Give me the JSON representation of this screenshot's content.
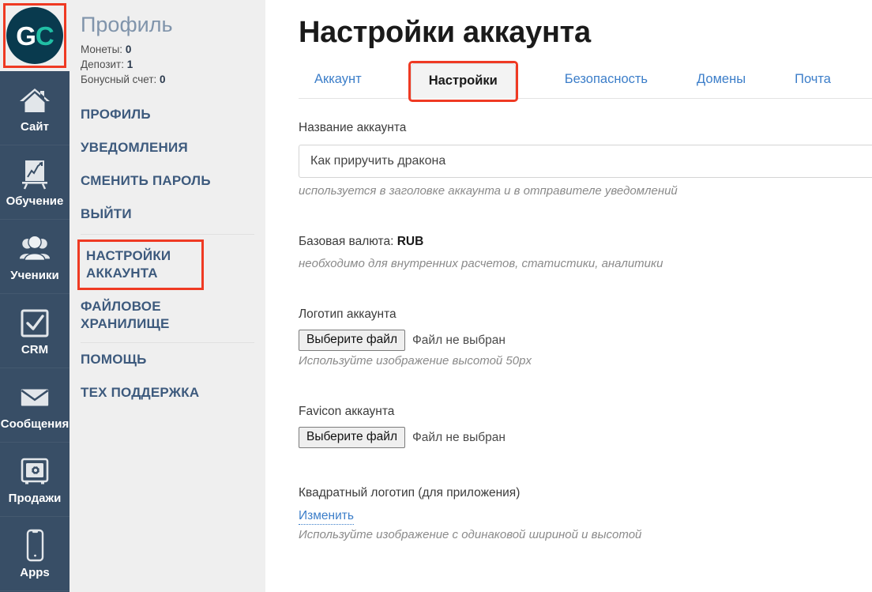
{
  "rail": {
    "logo": {
      "left": "G",
      "right": "C",
      "name": "gc-logo"
    },
    "items": [
      {
        "label": "Сайт",
        "icon": "home-icon"
      },
      {
        "label": "Обучение",
        "icon": "chart-board-icon"
      },
      {
        "label": "Ученики",
        "icon": "users-icon"
      },
      {
        "label": "CRM",
        "icon": "checkbox-check-icon"
      },
      {
        "label": "Сообщения",
        "icon": "envelope-icon"
      },
      {
        "label": "Продажи",
        "icon": "safe-box-icon"
      },
      {
        "label": "Apps",
        "icon": "phone-icon"
      }
    ]
  },
  "profile": {
    "title": "Профиль",
    "stats": [
      {
        "label": "Монеты:",
        "value": "0"
      },
      {
        "label": "Депозит:",
        "value": "1"
      },
      {
        "label": "Бонусный счет:",
        "value": "0"
      }
    ],
    "menu": [
      {
        "label": "ПРОФИЛЬ"
      },
      {
        "label": "УВЕДОМЛЕНИЯ"
      },
      {
        "label": "СМЕНИТЬ ПАРОЛЬ"
      },
      {
        "label": "ВЫЙТИ"
      },
      {
        "label": "НАСТРОЙКИ АККАУНТА"
      },
      {
        "label": "ФАЙЛОВОЕ ХРАНИЛИЩЕ"
      },
      {
        "label": "ПОМОЩЬ"
      },
      {
        "label": "ТЕХ ПОДДЕРЖКА"
      }
    ]
  },
  "main": {
    "page_title": "Настройки аккаунта",
    "tabs": [
      {
        "label": "Аккаунт",
        "active": false
      },
      {
        "label": "Настройки",
        "active": true
      },
      {
        "label": "Безопасность",
        "active": false
      },
      {
        "label": "Домены",
        "active": false
      },
      {
        "label": "Почта",
        "active": false
      }
    ],
    "fields": {
      "account_name": {
        "label": "Название аккаунта",
        "value": "Как приручить дракона",
        "placeholder": "Как приручить дракона",
        "hint": "используется в заголовке аккаунта и в отправителе уведомлений"
      },
      "base_currency": {
        "label": "Базовая валюта:",
        "value": "RUB",
        "hint": "необходимо для внутренних расчетов, статистики, аналитики"
      },
      "account_logo": {
        "label": "Логотип аккаунта",
        "button": "Выберите файл",
        "status": "Файл не выбран",
        "hint": "Используйте изображение высотой 50px"
      },
      "account_favicon": {
        "label": "Favicon аккаунта",
        "button": "Выберите файл",
        "status": "Файл не выбран"
      },
      "square_logo": {
        "label": "Квадратный логотип (для приложения)",
        "link": "Изменить",
        "hint": "Используйте изображение с одинаковой шириной и высотой"
      }
    }
  },
  "colors": {
    "rail_bg": "#384e66",
    "profile_bg": "#efefef",
    "highlight_red": "#ef3a23",
    "link_blue": "#3c7ec9",
    "logo_teal": "#21bfa5",
    "logo_dark": "#093a4e"
  }
}
